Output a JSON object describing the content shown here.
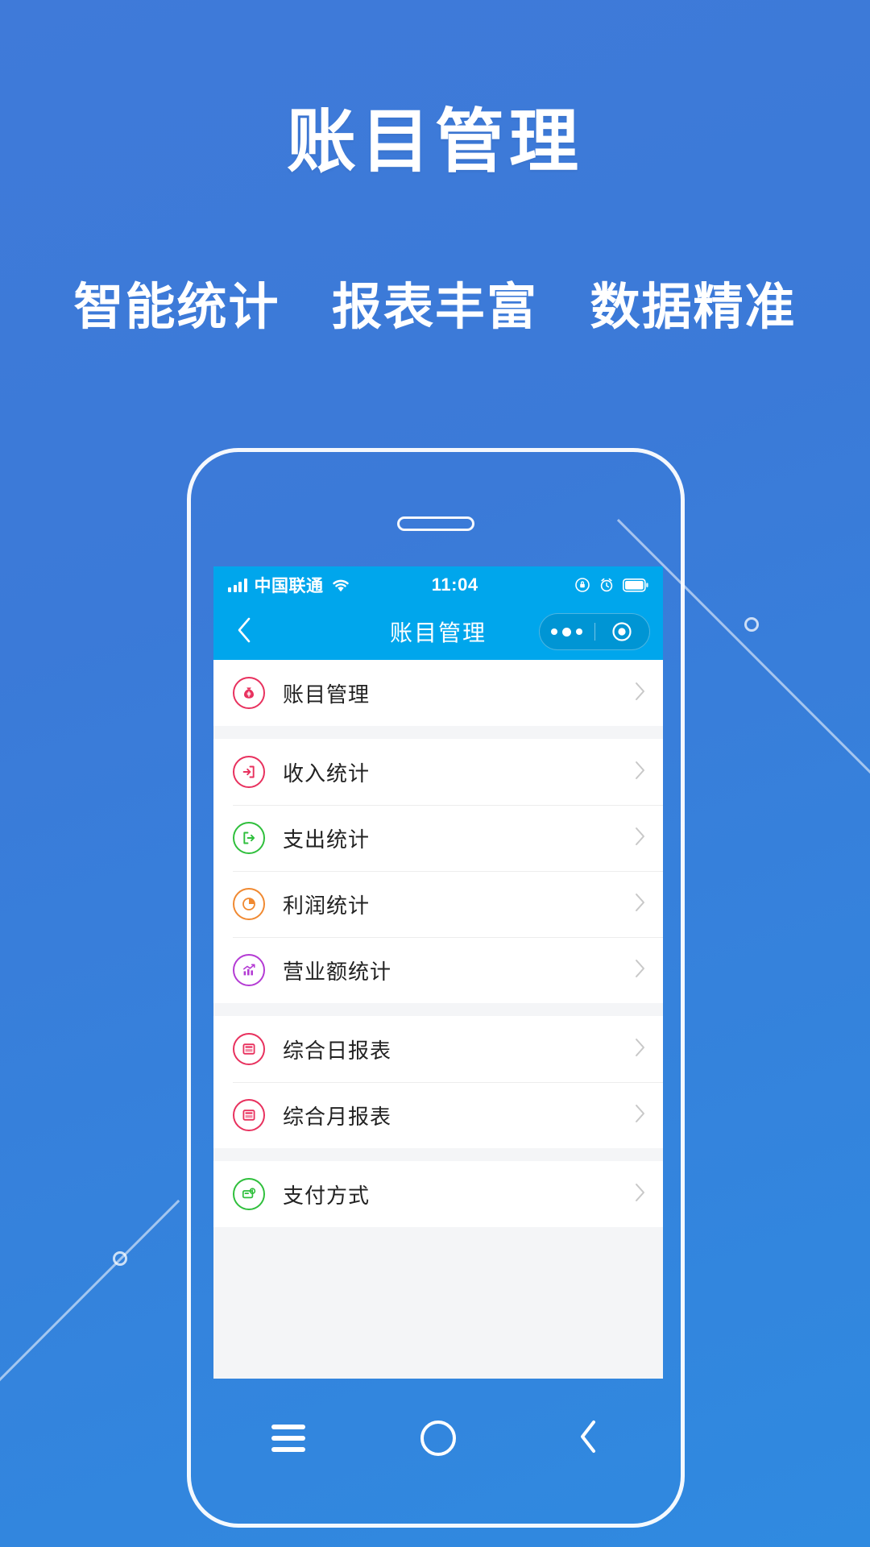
{
  "page": {
    "headline": "账目管理",
    "subheadline_parts": [
      "智能统计",
      "报表丰富",
      "数据精准"
    ],
    "background_color": "#3b7ad8",
    "accent_color": "#00a6ec"
  },
  "phone": {
    "status_bar": {
      "carrier": "中国联通",
      "time": "11:04",
      "signal_icon": "signal-bars-icon",
      "wifi_icon": "wifi-icon",
      "rotation_lock_icon": "rotation-lock-icon",
      "alarm_icon": "alarm-clock-icon",
      "battery_icon": "battery-icon"
    },
    "nav_bar": {
      "back_icon": "chevron-left-icon",
      "title": "账目管理",
      "capsule": {
        "more_icon": "more-dots-icon",
        "target_icon": "target-circle-icon"
      }
    },
    "list_groups": [
      {
        "items": [
          {
            "label": "账目管理",
            "icon": "money-bag-icon",
            "color": "#e8315e",
            "chevron": "chevron-right-icon"
          }
        ]
      },
      {
        "items": [
          {
            "label": "收入统计",
            "icon": "arrow-into-door-icon",
            "color": "#e8315e",
            "chevron": "chevron-right-icon"
          },
          {
            "label": "支出统计",
            "icon": "arrow-out-door-icon",
            "color": "#2fbf3c",
            "chevron": "chevron-right-icon"
          },
          {
            "label": "利润统计",
            "icon": "pie-chart-icon",
            "color": "#f08931",
            "chevron": "chevron-right-icon"
          },
          {
            "label": "营业额统计",
            "icon": "trend-chart-icon",
            "color": "#b43bd4",
            "chevron": "chevron-right-icon"
          }
        ]
      },
      {
        "items": [
          {
            "label": "综合日报表",
            "icon": "report-icon",
            "color": "#e8315e",
            "chevron": "chevron-right-icon"
          },
          {
            "label": "综合月报表",
            "icon": "report-icon",
            "color": "#e8315e",
            "chevron": "chevron-right-icon"
          }
        ]
      },
      {
        "items": [
          {
            "label": "支付方式",
            "icon": "payment-card-icon",
            "color": "#2fbf3c",
            "chevron": "chevron-right-icon"
          }
        ]
      }
    ],
    "android_nav": {
      "menu_icon": "menu-icon",
      "home_icon": "home-circle-icon",
      "back_icon": "chevron-left-icon"
    }
  }
}
